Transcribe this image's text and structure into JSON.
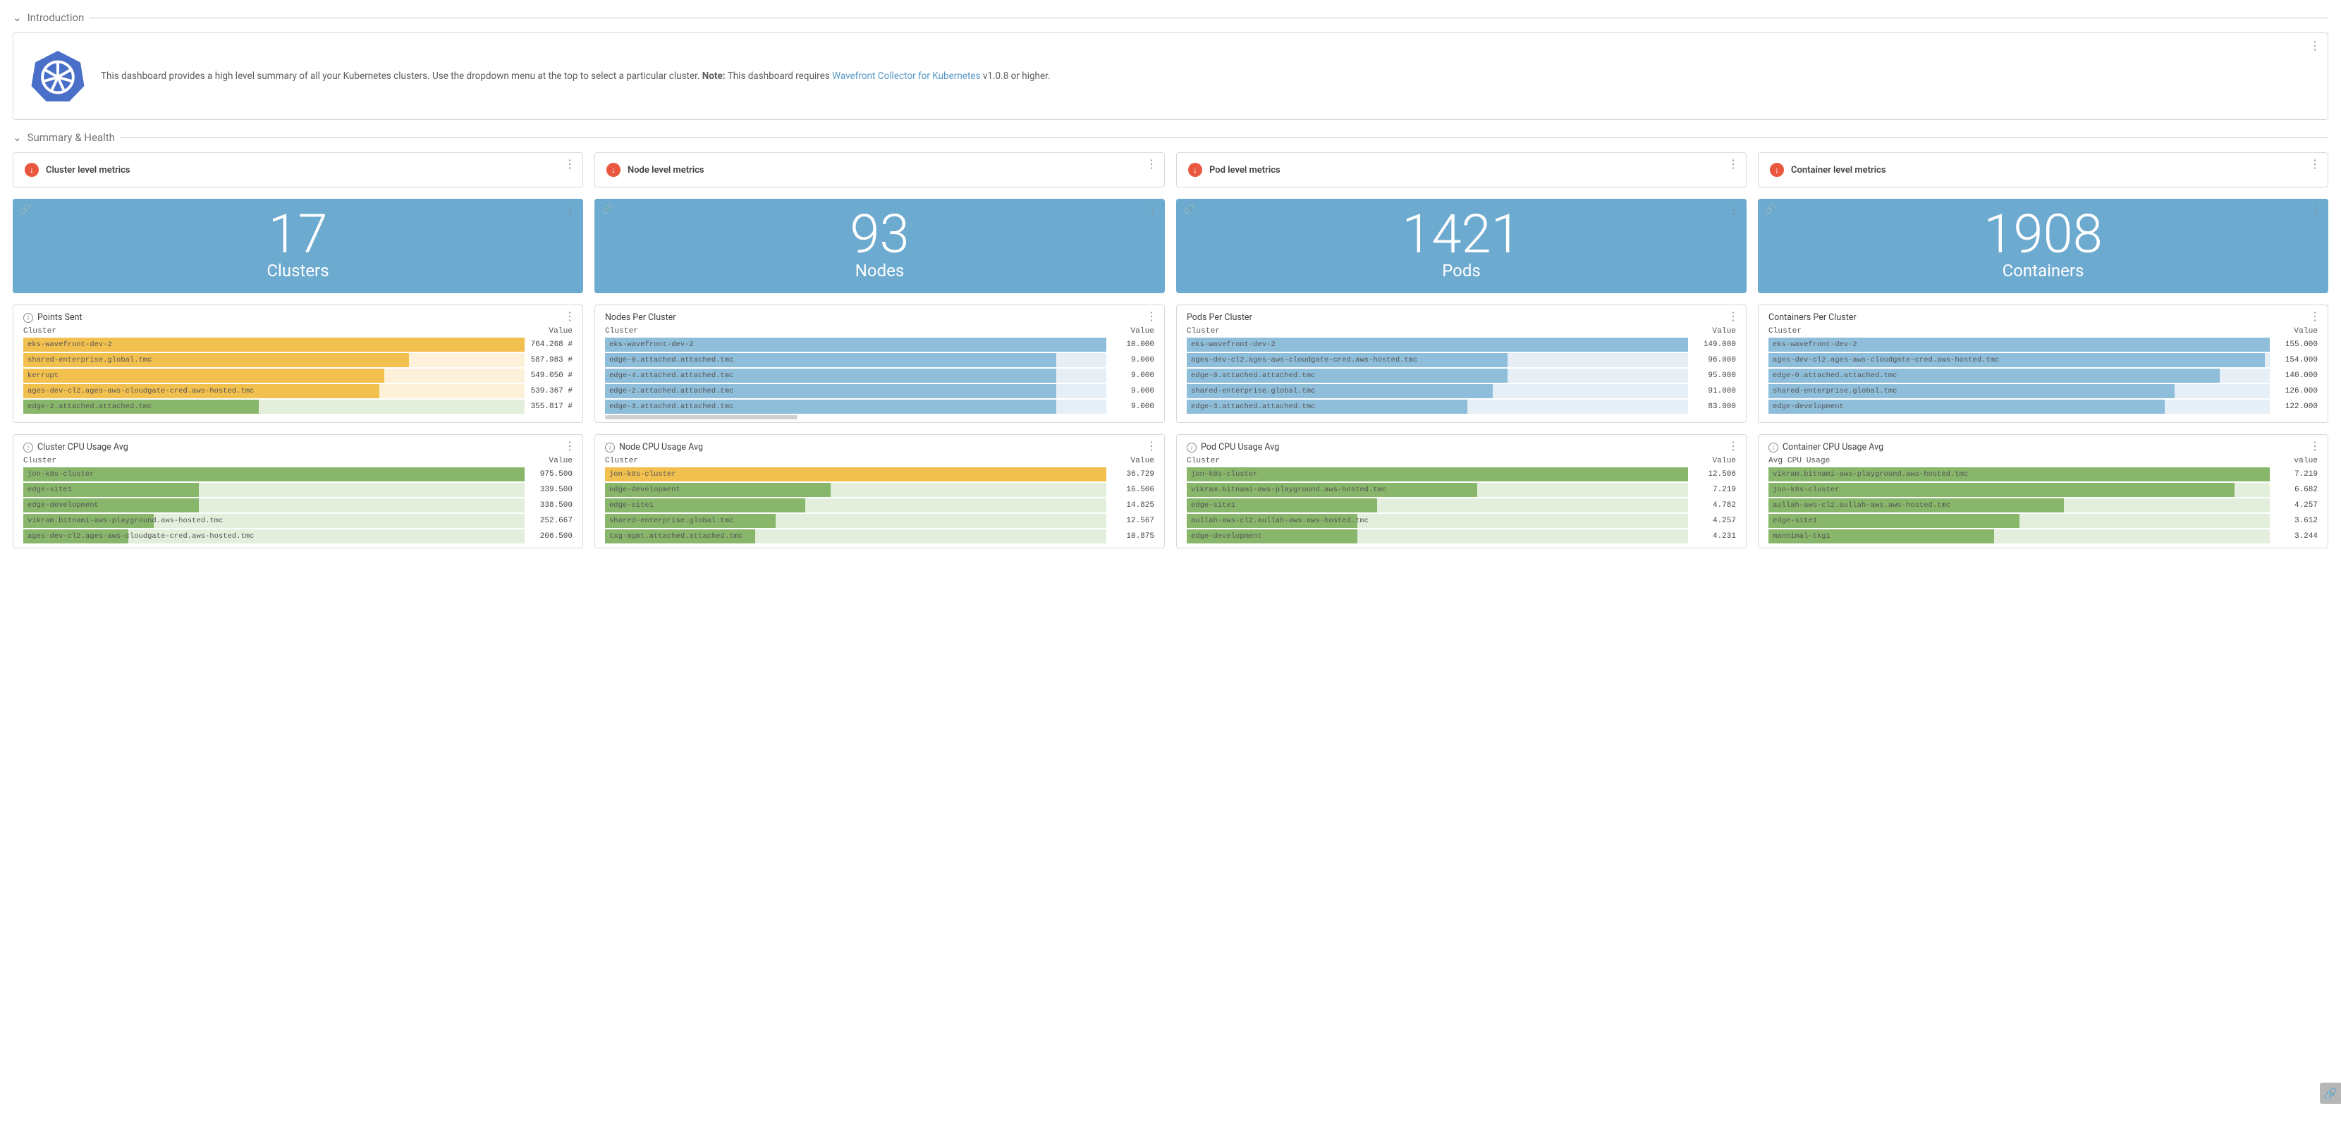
{
  "sections": {
    "intro": "Introduction",
    "summary": "Summary & Health"
  },
  "intro": {
    "text_before": "This dashboard provides a high level summary of all your Kubernetes clusters. Use the dropdown menu at the top to select a particular cluster. ",
    "note_label": "Note:",
    "text_after_note": " This dashboard requires ",
    "link_text": "Wavefront Collector for Kubernetes",
    "text_after_link": " v1.0.8 or higher."
  },
  "metric_titles": {
    "cluster": "Cluster level metrics",
    "node": "Node level metrics",
    "pod": "Pod level metrics",
    "container": "Container level metrics"
  },
  "big_tiles": {
    "clusters": {
      "value": "17",
      "label": "Clusters"
    },
    "nodes": {
      "value": "93",
      "label": "Nodes"
    },
    "pods": {
      "value": "1421",
      "label": "Pods"
    },
    "containers": {
      "value": "1908",
      "label": "Containers"
    }
  },
  "lists": {
    "points_sent": {
      "title": "Points Sent",
      "col_left": "Cluster",
      "col_right": "Value",
      "rows": [
        {
          "label": "eks-wavefront-dev-2",
          "value": "764.268 #",
          "pct": 100,
          "bg": "#fdf2d9",
          "fill": "#f2c04f"
        },
        {
          "label": "shared-enterprise.global.tmc",
          "value": "587.983 #",
          "pct": 77,
          "bg": "#fdf2d9",
          "fill": "#f2c04f"
        },
        {
          "label": "kerrupt",
          "value": "549.050 #",
          "pct": 72,
          "bg": "#fdf2d9",
          "fill": "#f2c04f"
        },
        {
          "label": "ages-dev-cl2.ages-aws-cloudgate-cred.aws-hosted.tmc",
          "value": "539.367 #",
          "pct": 71,
          "bg": "#fdf2d9",
          "fill": "#f2c04f"
        },
        {
          "label": "edge-2.attached.attached.tmc",
          "value": "355.817 #",
          "pct": 47,
          "bg": "#e3efdc",
          "fill": "#88b76b"
        }
      ]
    },
    "nodes_per_cluster": {
      "title": "Nodes Per Cluster",
      "col_left": "Cluster",
      "col_right": "Value",
      "rows": [
        {
          "label": "eks-wavefront-dev-2",
          "value": "10.000",
          "pct": 100,
          "bg": "#e6eff6",
          "fill": "#8fbedb"
        },
        {
          "label": "edge-0.attached.attached.tmc",
          "value": "9.000",
          "pct": 90,
          "bg": "#e6eff6",
          "fill": "#8fbedb"
        },
        {
          "label": "edge-4.attached.attached.tmc",
          "value": "9.000",
          "pct": 90,
          "bg": "#e6eff6",
          "fill": "#8fbedb"
        },
        {
          "label": "edge-2.attached.attached.tmc",
          "value": "9.000",
          "pct": 90,
          "bg": "#e6eff6",
          "fill": "#8fbedb"
        },
        {
          "label": "edge-3.attached.attached.tmc",
          "value": "9.000",
          "pct": 90,
          "bg": "#e6eff6",
          "fill": "#8fbedb"
        }
      ]
    },
    "pods_per_cluster": {
      "title": "Pods Per Cluster",
      "col_left": "Cluster",
      "col_right": "Value",
      "rows": [
        {
          "label": "eks-wavefront-dev-2",
          "value": "149.000",
          "pct": 100,
          "bg": "#e6eff6",
          "fill": "#8fbedb"
        },
        {
          "label": "ages-dev-cl2.ages-aws-cloudgate-cred.aws-hosted.tmc",
          "value": "96.000",
          "pct": 64,
          "bg": "#e6eff6",
          "fill": "#8fbedb"
        },
        {
          "label": "edge-0.attached.attached.tmc",
          "value": "95.000",
          "pct": 64,
          "bg": "#e6eff6",
          "fill": "#8fbedb"
        },
        {
          "label": "shared-enterprise.global.tmc",
          "value": "91.000",
          "pct": 61,
          "bg": "#e6eff6",
          "fill": "#8fbedb"
        },
        {
          "label": "edge-3.attached.attached.tmc",
          "value": "83.000",
          "pct": 56,
          "bg": "#e6eff6",
          "fill": "#8fbedb"
        }
      ]
    },
    "containers_per_cluster": {
      "title": "Containers Per Cluster",
      "col_left": "Cluster",
      "col_right": "Value",
      "rows": [
        {
          "label": "eks-wavefront-dev-2",
          "value": "155.000",
          "pct": 100,
          "bg": "#e6eff6",
          "fill": "#8fbedb"
        },
        {
          "label": "ages-dev-cl2.ages-aws-cloudgate-cred.aws-hosted.tmc",
          "value": "154.000",
          "pct": 99,
          "bg": "#e6eff6",
          "fill": "#8fbedb"
        },
        {
          "label": "edge-0.attached.attached.tmc",
          "value": "140.000",
          "pct": 90,
          "bg": "#e6eff6",
          "fill": "#8fbedb"
        },
        {
          "label": "shared-enterprise.global.tmc",
          "value": "126.000",
          "pct": 81,
          "bg": "#e6eff6",
          "fill": "#8fbedb"
        },
        {
          "label": "edge-development",
          "value": "122.000",
          "pct": 79,
          "bg": "#e6eff6",
          "fill": "#8fbedb"
        }
      ]
    },
    "cluster_cpu": {
      "title": "Cluster CPU Usage Avg",
      "col_left": "Cluster",
      "col_right": "Value",
      "rows": [
        {
          "label": "jon-k8s-cluster",
          "value": "975.500",
          "pct": 100,
          "bg": "#e3efdc",
          "fill": "#88b76b"
        },
        {
          "label": "edge-site1",
          "value": "339.500",
          "pct": 35,
          "bg": "#e3efdc",
          "fill": "#88b76b"
        },
        {
          "label": "edge-development",
          "value": "338.500",
          "pct": 35,
          "bg": "#e3efdc",
          "fill": "#88b76b"
        },
        {
          "label": "vikram.bitnami-aws-playground.aws-hosted.tmc",
          "value": "252.667",
          "pct": 26,
          "bg": "#e3efdc",
          "fill": "#88b76b"
        },
        {
          "label": "ages-dev-cl2.ages-aws-cloudgate-cred.aws-hosted.tmc",
          "value": "206.500",
          "pct": 21,
          "bg": "#e3efdc",
          "fill": "#88b76b"
        }
      ]
    },
    "node_cpu": {
      "title": "Node CPU Usage Avg",
      "col_left": "Cluster",
      "col_right": "Value",
      "rows": [
        {
          "label": "jon-k8s-cluster",
          "value": "36.729",
          "pct": 100,
          "bg": "#fdf2d9",
          "fill": "#f2c04f"
        },
        {
          "label": "edge-development",
          "value": "16.506",
          "pct": 45,
          "bg": "#e3efdc",
          "fill": "#88b76b"
        },
        {
          "label": "edge-site1",
          "value": "14.825",
          "pct": 40,
          "bg": "#e3efdc",
          "fill": "#88b76b"
        },
        {
          "label": "shared-enterprise.global.tmc",
          "value": "12.567",
          "pct": 34,
          "bg": "#e3efdc",
          "fill": "#88b76b"
        },
        {
          "label": "txg-mgmt.attached.attached.tmc",
          "value": "10.875",
          "pct": 30,
          "bg": "#e3efdc",
          "fill": "#88b76b"
        }
      ]
    },
    "pod_cpu": {
      "title": "Pod CPU Usage Avg",
      "col_left": "Cluster",
      "col_right": "Value",
      "rows": [
        {
          "label": "jon-k8s-cluster",
          "value": "12.506",
          "pct": 100,
          "bg": "#e3efdc",
          "fill": "#88b76b"
        },
        {
          "label": "vikram.bitnami-aws-playground.aws-hosted.tmc",
          "value": "7.219",
          "pct": 58,
          "bg": "#e3efdc",
          "fill": "#88b76b"
        },
        {
          "label": "edge-site1",
          "value": "4.782",
          "pct": 38,
          "bg": "#e3efdc",
          "fill": "#88b76b"
        },
        {
          "label": "aullah-aws-cl2.aullah-aws.aws-hosted.tmc",
          "value": "4.257",
          "pct": 34,
          "bg": "#e3efdc",
          "fill": "#88b76b"
        },
        {
          "label": "edge-development",
          "value": "4.231",
          "pct": 34,
          "bg": "#e3efdc",
          "fill": "#88b76b"
        }
      ]
    },
    "container_cpu": {
      "title": "Container CPU Usage Avg",
      "col_left": "Avg CPU Usage",
      "col_right": "value",
      "rows": [
        {
          "label": "vikram.bitnami-aws-playground.aws-hosted.tmc",
          "value": "7.219",
          "pct": 100,
          "bg": "#e3efdc",
          "fill": "#88b76b"
        },
        {
          "label": "jon-k8s-cluster",
          "value": "6.682",
          "pct": 93,
          "bg": "#e3efdc",
          "fill": "#88b76b"
        },
        {
          "label": "aullah-aws-cl2.aullah-aws.aws-hosted.tmc",
          "value": "4.257",
          "pct": 59,
          "bg": "#e3efdc",
          "fill": "#88b76b"
        },
        {
          "label": "edge-site1",
          "value": "3.612",
          "pct": 50,
          "bg": "#e3efdc",
          "fill": "#88b76b"
        },
        {
          "label": "mannimal-tkg1",
          "value": "3.244",
          "pct": 45,
          "bg": "#e3efdc",
          "fill": "#88b76b"
        }
      ]
    }
  }
}
